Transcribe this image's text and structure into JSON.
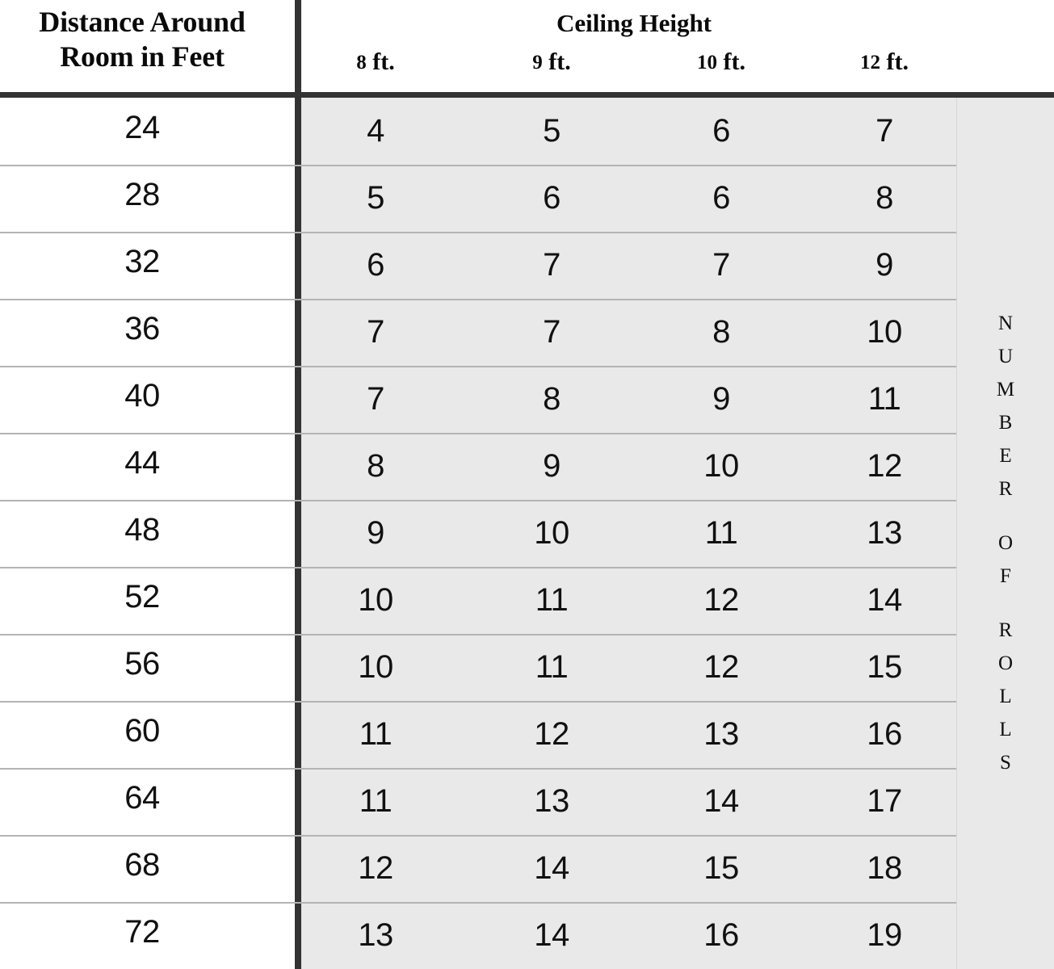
{
  "table": {
    "row_header_title": "Distance Around Room in Feet",
    "row_header_line1": "Distance Around",
    "row_header_line2": "Room in Feet",
    "column_group_title": "Ceiling Height",
    "column_headers": [
      "8 ft.",
      "9 ft.",
      "10 ft.",
      "12 ft."
    ],
    "column_headers_parts": [
      {
        "num": "8",
        "unit": " ft."
      },
      {
        "num": "9",
        "unit": " ft."
      },
      {
        "num": "10",
        "unit": " ft."
      },
      {
        "num": "12",
        "unit": " ft."
      }
    ],
    "side_label": "NUMBER OF ROLLS",
    "side_label_words": [
      "NUMBER",
      "OF",
      "ROLLS"
    ],
    "row_header_values": [
      24,
      28,
      32,
      36,
      40,
      44,
      48,
      52,
      56,
      60,
      64,
      68,
      72
    ],
    "rows": [
      {
        "distance": "24",
        "values": [
          "4",
          "5",
          "6",
          "7"
        ]
      },
      {
        "distance": "28",
        "values": [
          "5",
          "6",
          "6",
          "8"
        ]
      },
      {
        "distance": "32",
        "values": [
          "6",
          "7",
          "7",
          "9"
        ]
      },
      {
        "distance": "36",
        "values": [
          "7",
          "7",
          "8",
          "10"
        ]
      },
      {
        "distance": "40",
        "values": [
          "7",
          "8",
          "9",
          "11"
        ]
      },
      {
        "distance": "44",
        "values": [
          "8",
          "9",
          "10",
          "12"
        ]
      },
      {
        "distance": "48",
        "values": [
          "9",
          "10",
          "11",
          "13"
        ]
      },
      {
        "distance": "52",
        "values": [
          "10",
          "11",
          "12",
          "14"
        ]
      },
      {
        "distance": "56",
        "values": [
          "10",
          "11",
          "12",
          "15"
        ]
      },
      {
        "distance": "60",
        "values": [
          "11",
          "12",
          "13",
          "16"
        ]
      },
      {
        "distance": "64",
        "values": [
          "11",
          "13",
          "14",
          "17"
        ]
      },
      {
        "distance": "68",
        "values": [
          "12",
          "14",
          "15",
          "18"
        ]
      },
      {
        "distance": "72",
        "values": [
          "13",
          "14",
          "16",
          "19"
        ]
      }
    ],
    "colors": {
      "data_background": "#e9e9e9",
      "page_background": "#ffffff",
      "heavy_rule": "#333333",
      "row_separator": "#b4b4b4",
      "text": "#111111"
    }
  },
  "chart_data": {
    "type": "table",
    "title": "Distance Around Room in Feet vs Ceiling Height",
    "xlabel": "Ceiling Height",
    "ylabel": "Distance Around Room in Feet",
    "value_label": "NUMBER OF ROLLS",
    "categories": [
      "8 ft.",
      "9 ft.",
      "10 ft.",
      "12 ft."
    ],
    "index": [
      24,
      28,
      32,
      36,
      40,
      44,
      48,
      52,
      56,
      60,
      64,
      68,
      72
    ],
    "series": [
      {
        "name": "8 ft.",
        "values": [
          4,
          5,
          6,
          7,
          7,
          8,
          9,
          10,
          10,
          11,
          11,
          12,
          13
        ]
      },
      {
        "name": "9 ft.",
        "values": [
          5,
          6,
          7,
          7,
          8,
          9,
          10,
          11,
          11,
          12,
          13,
          14,
          14
        ]
      },
      {
        "name": "10 ft.",
        "values": [
          6,
          6,
          7,
          8,
          9,
          10,
          11,
          12,
          12,
          13,
          14,
          15,
          16
        ]
      },
      {
        "name": "12 ft.",
        "values": [
          7,
          8,
          9,
          10,
          11,
          12,
          13,
          14,
          15,
          16,
          17,
          18,
          19
        ]
      }
    ],
    "grid": true,
    "legend": "none"
  }
}
